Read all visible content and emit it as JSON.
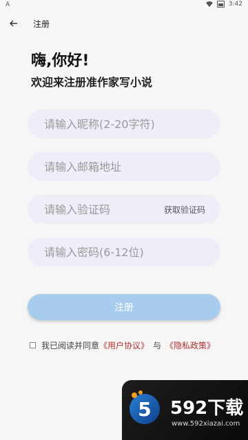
{
  "status": {
    "time": "3:42",
    "left_icon": "A"
  },
  "header": {
    "title": "注册"
  },
  "greeting": {
    "hello": "嗨,你好!",
    "subtitle": "欢迎来注册准作家写小说"
  },
  "form": {
    "nickname_placeholder": "请输入昵称(2-20字符)",
    "email_placeholder": "请输入邮箱地址",
    "code_placeholder": "请输入验证码",
    "get_code_label": "获取验证码",
    "password_placeholder": "请输入密码(6-12位)",
    "register_label": "注册"
  },
  "agreement": {
    "prefix": "我已阅读并同意",
    "user_agreement": "《用户协议》",
    "and": "与",
    "privacy_policy": "《隐私政策》"
  },
  "watermark": {
    "brand": "592下载",
    "url": "www.592xiazai.com",
    "logo_letter": "5"
  },
  "colors": {
    "accent_button": "#a8cceb",
    "field_bg": "#eeeef8",
    "link_red": "#b03030"
  }
}
